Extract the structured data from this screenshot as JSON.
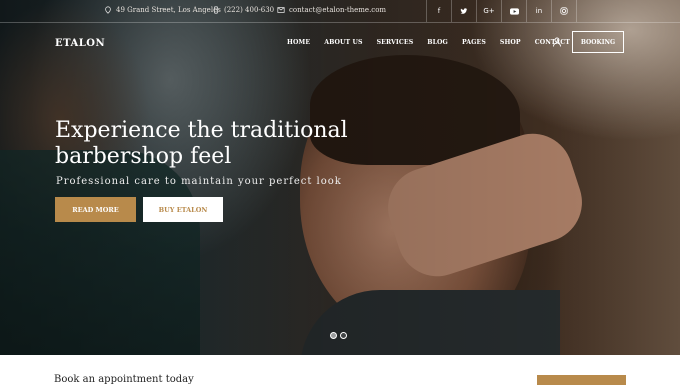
{
  "topbar": {
    "address": "49 Grand Street, Los Angeles",
    "phone": "(222) 400-630",
    "email": "contact@etalon-theme.com",
    "socials": [
      "f",
      "t",
      "G+",
      "yt",
      "in",
      "ig"
    ]
  },
  "header": {
    "logo": "ETALON",
    "nav": [
      "HOME",
      "ABOUT US",
      "SERVICES",
      "BLOG",
      "PAGES",
      "SHOP",
      "CONTACT"
    ],
    "booking_label": "BOOKING"
  },
  "hero": {
    "title_line1": "Experience the traditional",
    "title_line2": "barbershop feel",
    "subtitle": "Professional care to maintain your perfect look",
    "read_more": "READ MORE",
    "buy": "BUY ETALON",
    "slide_count": 2,
    "active_slide": 2
  },
  "appointment": {
    "title": "Book an appointment today"
  },
  "colors": {
    "accent": "#b88a4b"
  }
}
